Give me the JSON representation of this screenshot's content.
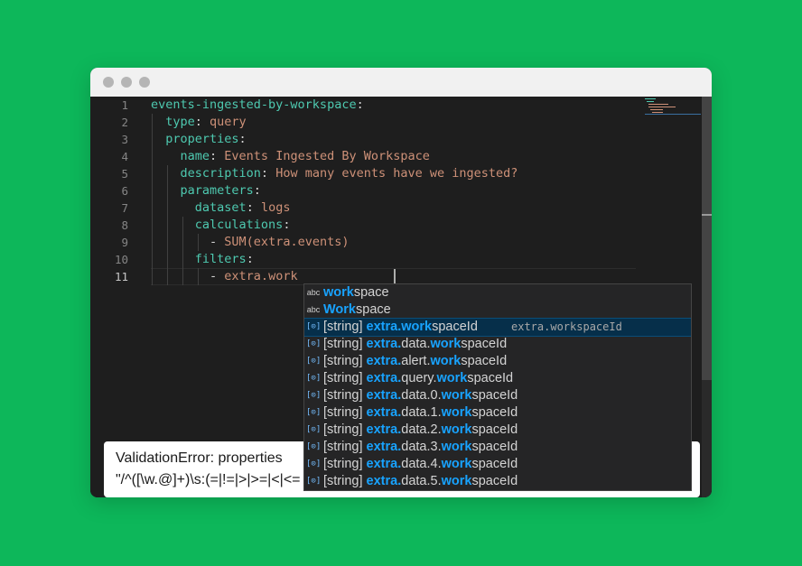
{
  "editor": {
    "lines": [
      {
        "num": "1",
        "parts": [
          {
            "t": "events-ingested-by-workspace",
            "c": "k"
          },
          {
            "t": ":",
            "c": "p"
          }
        ]
      },
      {
        "num": "2",
        "parts": [
          {
            "t": "  "
          },
          {
            "t": "type",
            "c": "k"
          },
          {
            "t": ": ",
            "c": "p"
          },
          {
            "t": "query",
            "c": "s"
          }
        ]
      },
      {
        "num": "3",
        "parts": [
          {
            "t": "  "
          },
          {
            "t": "properties",
            "c": "k"
          },
          {
            "t": ":",
            "c": "p"
          }
        ]
      },
      {
        "num": "4",
        "parts": [
          {
            "t": "    "
          },
          {
            "t": "name",
            "c": "k"
          },
          {
            "t": ": ",
            "c": "p"
          },
          {
            "t": "Events Ingested By Workspace",
            "c": "s"
          }
        ]
      },
      {
        "num": "5",
        "parts": [
          {
            "t": "    "
          },
          {
            "t": "description",
            "c": "k"
          },
          {
            "t": ": ",
            "c": "p"
          },
          {
            "t": "How many events have we ingested?",
            "c": "s"
          }
        ]
      },
      {
        "num": "6",
        "parts": [
          {
            "t": "    "
          },
          {
            "t": "parameters",
            "c": "k"
          },
          {
            "t": ":",
            "c": "p"
          }
        ]
      },
      {
        "num": "7",
        "parts": [
          {
            "t": "      "
          },
          {
            "t": "dataset",
            "c": "k"
          },
          {
            "t": ": ",
            "c": "p"
          },
          {
            "t": "logs",
            "c": "s"
          }
        ]
      },
      {
        "num": "8",
        "parts": [
          {
            "t": "      "
          },
          {
            "t": "calculations",
            "c": "k"
          },
          {
            "t": ":",
            "c": "p"
          }
        ]
      },
      {
        "num": "9",
        "parts": [
          {
            "t": "        "
          },
          {
            "t": "- ",
            "c": "p"
          },
          {
            "t": "SUM(extra.events)",
            "c": "s"
          }
        ]
      },
      {
        "num": "10",
        "parts": [
          {
            "t": "      "
          },
          {
            "t": "filters",
            "c": "k"
          },
          {
            "t": ":",
            "c": "p"
          }
        ]
      },
      {
        "num": "11",
        "parts": [
          {
            "t": "        "
          },
          {
            "t": "- ",
            "c": "p"
          },
          {
            "t": "extra.work",
            "c": "s"
          }
        ]
      }
    ],
    "active_line": "11"
  },
  "suggestions": [
    {
      "icon": "abc",
      "kind": "word",
      "prefix": "",
      "hl1": "",
      "mid": "",
      "hl2": "work",
      "rest": "space",
      "detail": ""
    },
    {
      "icon": "abc",
      "kind": "word",
      "prefix": "",
      "hl1": "",
      "mid": "",
      "hl2": "Work",
      "rest": "space",
      "detail": ""
    },
    {
      "icon": "[⊙]",
      "kind": "variable",
      "prefix": "[string] ",
      "hl1": "extra.",
      "mid": "",
      "hl2": "work",
      "rest": "spaceId",
      "detail": "extra.workspaceId",
      "selected": true
    },
    {
      "icon": "[⊙]",
      "kind": "variable",
      "prefix": "[string] ",
      "hl1": "extra.",
      "mid": "data.",
      "hl2": "work",
      "rest": "spaceId",
      "detail": ""
    },
    {
      "icon": "[⊙]",
      "kind": "variable",
      "prefix": "[string] ",
      "hl1": "extra.",
      "mid": "alert.",
      "hl2": "work",
      "rest": "spaceId",
      "detail": ""
    },
    {
      "icon": "[⊙]",
      "kind": "variable",
      "prefix": "[string] ",
      "hl1": "extra.",
      "mid": "query.",
      "hl2": "work",
      "rest": "spaceId",
      "detail": ""
    },
    {
      "icon": "[⊙]",
      "kind": "variable",
      "prefix": "[string] ",
      "hl1": "extra.",
      "mid": "data.0.",
      "hl2": "work",
      "rest": "spaceId",
      "detail": ""
    },
    {
      "icon": "[⊙]",
      "kind": "variable",
      "prefix": "[string] ",
      "hl1": "extra.",
      "mid": "data.1.",
      "hl2": "work",
      "rest": "spaceId",
      "detail": ""
    },
    {
      "icon": "[⊙]",
      "kind": "variable",
      "prefix": "[string] ",
      "hl1": "extra.",
      "mid": "data.2.",
      "hl2": "work",
      "rest": "spaceId",
      "detail": ""
    },
    {
      "icon": "[⊙]",
      "kind": "variable",
      "prefix": "[string] ",
      "hl1": "extra.",
      "mid": "data.3.",
      "hl2": "work",
      "rest": "spaceId",
      "detail": ""
    },
    {
      "icon": "[⊙]",
      "kind": "variable",
      "prefix": "[string] ",
      "hl1": "extra.",
      "mid": "data.4.",
      "hl2": "work",
      "rest": "spaceId",
      "detail": ""
    },
    {
      "icon": "[⊙]",
      "kind": "variable",
      "prefix": "[string] ",
      "hl1": "extra.",
      "mid": "data.5.",
      "hl2": "work",
      "rest": "spaceId",
      "detail": ""
    }
  ],
  "error": {
    "line1": "ValidationError: properties",
    "line2": "\"/^([\\w.@]+)\\s:(=|!=|>|>=|<|<="
  },
  "colors": {
    "background": "#0db75a",
    "editor_bg": "#1e1e1e",
    "key": "#4ec9b0",
    "string": "#ce9178",
    "match_highlight": "#18a3ff",
    "selected_row": "#062f4a"
  }
}
